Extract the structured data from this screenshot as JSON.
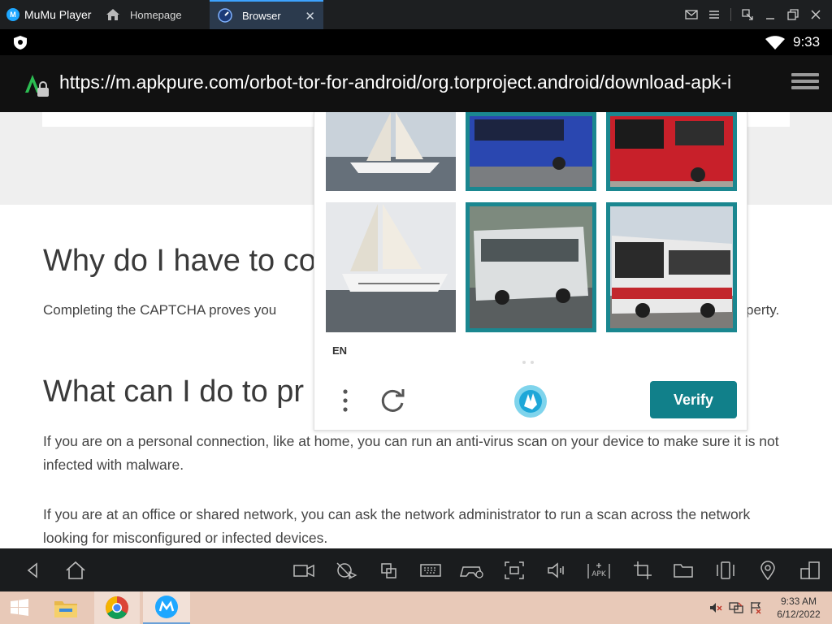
{
  "emulator": {
    "app_name": "MuMu Player",
    "tabs": [
      {
        "label": "Homepage",
        "icon": "home-icon"
      },
      {
        "label": "Browser",
        "icon": "browser-compass-icon",
        "active": true
      }
    ],
    "window_controls": [
      "mail-icon",
      "menu-icon",
      "shrink-icon",
      "minimize-icon",
      "restore-icon",
      "close-icon"
    ]
  },
  "android_status": {
    "time": "9:33",
    "icons": [
      "shield-icon",
      "wifi-icon"
    ]
  },
  "browser": {
    "url": "https://m.apkpure.com/orbot-tor-for-android/org.torproject.android/download-apk-i"
  },
  "page": {
    "heading_why": "Why do I have to co",
    "captcha_text_start": "Completing the CAPTCHA proves you",
    "captcha_text_end": "perty.",
    "heading_what": "What can I do to pr",
    "paragraph_personal": "If you are on a personal connection, like at home, you can run an anti-virus scan on your device to make sure it is not infected with malware.",
    "paragraph_office": "If you are at an office or shared network, you can ask the network administrator to run a scan across the network looking for misconfigured or infected devices."
  },
  "captcha": {
    "language": "EN",
    "verify_label": "Verify",
    "tiles": [
      {
        "subject": "sailboat",
        "selected": false
      },
      {
        "subject": "blue-bus",
        "selected": true
      },
      {
        "subject": "red-bus",
        "selected": true
      },
      {
        "subject": "sailboat",
        "selected": false
      },
      {
        "subject": "white-bus",
        "selected": true
      },
      {
        "subject": "red-white-bus",
        "selected": true
      }
    ],
    "accent_color": "#11808a"
  },
  "android_nav": [
    "back-icon",
    "home-icon",
    "video-record-icon",
    "operation-record-icon",
    "multi-window-icon",
    "keyboard-icon",
    "gamepad-icon",
    "screenshot-icon",
    "volume-icon",
    "apk-install-icon",
    "crop-icon",
    "folder-icon",
    "rotate-icon",
    "location-icon",
    "multi-instance-icon"
  ],
  "taskbar": {
    "time": "9:33 AM",
    "date": "6/12/2022",
    "apps": [
      "windows-start-icon",
      "file-explorer-icon",
      "chrome-icon",
      "mumu-player-icon"
    ]
  }
}
